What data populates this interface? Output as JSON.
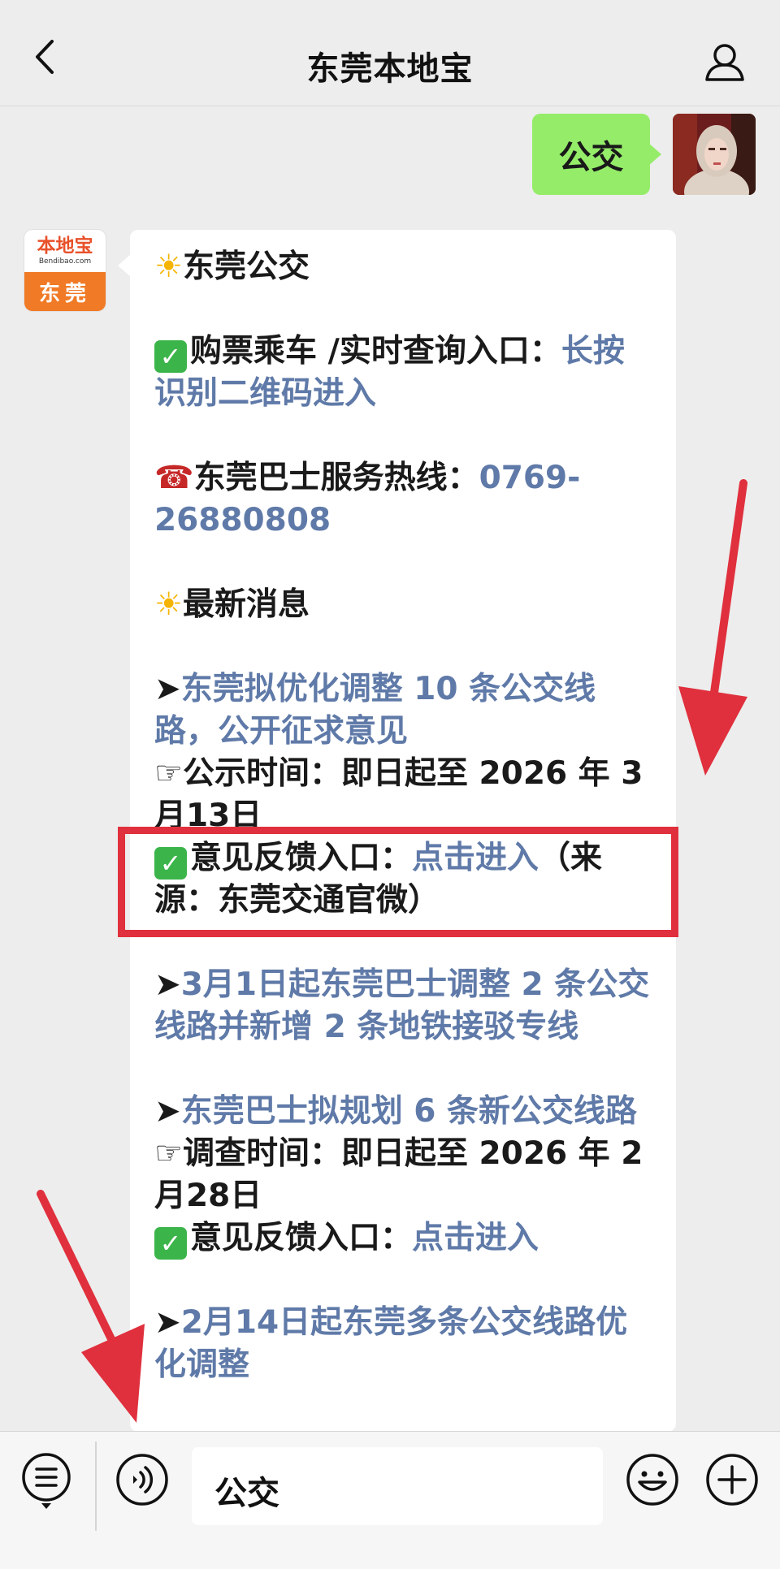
{
  "header": {
    "title": "东莞本地宝"
  },
  "sent_message": {
    "text": "公交"
  },
  "bot": {
    "brand": "本地宝",
    "url": "Bendibao.com",
    "city": "东莞"
  },
  "message": {
    "l1_text": "东莞公交",
    "l2_label": "购票乘车 /实时查询入口：",
    "l2_link": "长按识别二维码进入",
    "l3_label": "东莞巴士服务热线：",
    "l3_link": "0769-26880808",
    "l4_text": "最新消息",
    "n1_bullet": "➤",
    "n1_link": "东莞拟优化调整 10 条公交线路，公开征求意见",
    "n1_time_icon": "☞",
    "n1_time": "公示时间：即日起至 2026 年 3 月13日",
    "n1_fb_label": "意见反馈入口：",
    "n1_fb_link": "点击进入",
    "n1_fb_source": "（来源：东莞交通官微）",
    "n2_bullet": "➤",
    "n2_link": "3月1日起东莞巴士调整 2 条公交线路并新增 2 条地铁接驳专线",
    "n3_bullet": "➤",
    "n3_link": "东莞巴士拟规划 6 条新公交线路",
    "n3_time_icon": "☞",
    "n3_time": "调查时间：即日起至 2026 年 2 月28日",
    "n3_fb_label": "意见反馈入口：",
    "n3_fb_link": "点击进入",
    "n4_bullet": "➤",
    "n4_link": "2月14日起东莞多条公交线路优化调整"
  },
  "input": {
    "value": "公交"
  },
  "colors": {
    "link": "#5f7aa8",
    "sent_bubble": "#95ec69",
    "highlight": "#e0303d",
    "brand_orange": "#f07a25"
  }
}
